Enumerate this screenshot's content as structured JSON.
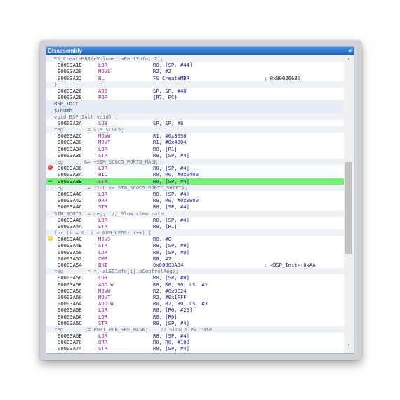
{
  "window": {
    "title": "Disassembly",
    "close_icon": "close-icon"
  },
  "scrollbar": {
    "up_icon": "chevron-up-icon",
    "down_icon": "chevron-down-icon",
    "position": 0.52,
    "thumb_fraction": 0.33
  },
  "rows": [
    {
      "type": "src",
      "text": "FS_CreateMBR(eVolume, aPartInfo, 2);"
    },
    {
      "type": "ins",
      "addr": "00003A1E",
      "mn": "LDR",
      "ops": "R0, [SP, #44]",
      "cmt": ""
    },
    {
      "type": "ins",
      "addr": "00003A20",
      "mn": "MOVS",
      "ops": "R2, #2",
      "cmt": ""
    },
    {
      "type": "ins",
      "addr": "00003A22",
      "mn": "BL",
      "ops": "FS_CreateMBR",
      "cmt": "; 0x000266B0"
    },
    {
      "type": "src",
      "text": "}"
    },
    {
      "type": "ins",
      "addr": "00003A26",
      "mn": "ADD",
      "ops": "SP, SP, #48",
      "cmt": ""
    },
    {
      "type": "ins",
      "addr": "00003A28",
      "mn": "POP",
      "ops": "{R7, PC}",
      "cmt": ""
    },
    {
      "type": "label",
      "text": "BSP_Init"
    },
    {
      "type": "label",
      "text": "$Thumb"
    },
    {
      "type": "src",
      "text": "void BSP_Init(void) {"
    },
    {
      "type": "ins",
      "addr": "00003A2A",
      "mn": "SUB",
      "ops": "SP, SP, #8",
      "cmt": ""
    },
    {
      "type": "src",
      "text": "reg        = SIM_SCGC5;"
    },
    {
      "type": "ins",
      "addr": "00003A2C",
      "mn": "MOVW",
      "ops": "R1, #0x8038",
      "cmt": ""
    },
    {
      "type": "ins",
      "addr": "00003A30",
      "mn": "MOVT",
      "ops": "R1, #0x4004",
      "cmt": ""
    },
    {
      "type": "ins",
      "addr": "00003A34",
      "mn": "LDR",
      "ops": "R0, [R1]",
      "cmt": ""
    },
    {
      "type": "ins",
      "addr": "00003A36",
      "mn": "STR",
      "ops": "R0, [SP, #4]",
      "cmt": ""
    },
    {
      "type": "src",
      "text": "reg       &= ~SIM_SCGC5_PORTB_MASK;"
    },
    {
      "type": "ins",
      "addr": "00003A38",
      "mn": "LDR",
      "ops": "R0, [SP, #4]",
      "cmt": "",
      "marker": "breakpoint"
    },
    {
      "type": "ins",
      "addr": "00003A3A",
      "mn": "BIC",
      "ops": "R0, R0, #0x0400",
      "cmt": ""
    },
    {
      "type": "ins",
      "addr": "00003A3E",
      "mn": "STR",
      "ops": "R0, [SP, #4]",
      "cmt": "",
      "marker": "current"
    },
    {
      "type": "src",
      "text": "reg       |= (1uL << SIM_SCGC5_PORTC_SHIFT);"
    },
    {
      "type": "ins",
      "addr": "00003A40",
      "mn": "LDR",
      "ops": "R0, [SP, #4]",
      "cmt": ""
    },
    {
      "type": "ins",
      "addr": "00003A42",
      "mn": "ORR",
      "ops": "R0, R0, #0x0800",
      "cmt": ""
    },
    {
      "type": "ins",
      "addr": "00003A46",
      "mn": "STR",
      "ops": "R0, [SP, #4]",
      "cmt": ""
    },
    {
      "type": "src",
      "text": "SIM_SCGC5  = reg;  // Slow slew rate"
    },
    {
      "type": "ins",
      "addr": "00003A48",
      "mn": "LDR",
      "ops": "R0, [SP, #4]",
      "cmt": ""
    },
    {
      "type": "ins",
      "addr": "00003A4A",
      "mn": "STR",
      "ops": "R0, [R1]",
      "cmt": ""
    },
    {
      "type": "src",
      "text": "for (i = 0; i < NUM_LEDS; i++) {"
    },
    {
      "type": "ins",
      "addr": "00003A4C",
      "mn": "MOVS",
      "ops": "R0, #0",
      "cmt": "",
      "marker": "bookmark"
    },
    {
      "type": "ins",
      "addr": "00003A4E",
      "mn": "STR",
      "ops": "R0, [SP, #0]",
      "cmt": ""
    },
    {
      "type": "ins",
      "addr": "00003A50",
      "mn": "LDR",
      "ops": "R0, [SP, #0]",
      "cmt": ""
    },
    {
      "type": "ins",
      "addr": "00003A52",
      "mn": "CMP",
      "ops": "R0, #7",
      "cmt": ""
    },
    {
      "type": "ins",
      "addr": "00003A54",
      "mn": "BHI",
      "ops": "0x00003AD4",
      "cmt": "; <BSP_Init>+0xAA"
    },
    {
      "type": "src",
      "text": "reg        = *(_aLEDInfo[i].pControlReg);"
    },
    {
      "type": "ins",
      "addr": "00003A56",
      "mn": "LDR",
      "ops": "R0, [SP, #0]",
      "cmt": ""
    },
    {
      "type": "ins",
      "addr": "00003A58",
      "mn": "ADD.W",
      "ops": "R0, R0, R0, LSL #1",
      "cmt": ""
    },
    {
      "type": "ins",
      "addr": "00003A5C",
      "mn": "MOVW",
      "ops": "R2, #0x9C24",
      "cmt": ""
    },
    {
      "type": "ins",
      "addr": "00003A60",
      "mn": "MOVT",
      "ops": "R2, #0x1FFF",
      "cmt": ""
    },
    {
      "type": "ins",
      "addr": "00003A64",
      "mn": "ADD.W",
      "ops": "R0, R2, R0, LSL #3",
      "cmt": ""
    },
    {
      "type": "ins",
      "addr": "00003A68",
      "mn": "LDR",
      "ops": "R0, [R0, #20]",
      "cmt": ""
    },
    {
      "type": "ins",
      "addr": "00003A6A",
      "mn": "LDR",
      "ops": "R0, [R0]",
      "cmt": ""
    },
    {
      "type": "ins",
      "addr": "00003A6C",
      "mn": "STR",
      "ops": "R0, [SP, #4]",
      "cmt": ""
    },
    {
      "type": "src",
      "text": "reg       |= PORT_PCR_SRE_MASK;    // Slow slew rate"
    },
    {
      "type": "ins",
      "addr": "00003A6E",
      "mn": "LDR",
      "ops": "R0, [SP, #4]",
      "cmt": ""
    },
    {
      "type": "ins",
      "addr": "00003A70",
      "mn": "ORR",
      "ops": "R0, R0, #100",
      "cmt": ""
    },
    {
      "type": "ins",
      "addr": "00003A74",
      "mn": "STR",
      "ops": "R0, [SP, #4]",
      "cmt": ""
    }
  ]
}
